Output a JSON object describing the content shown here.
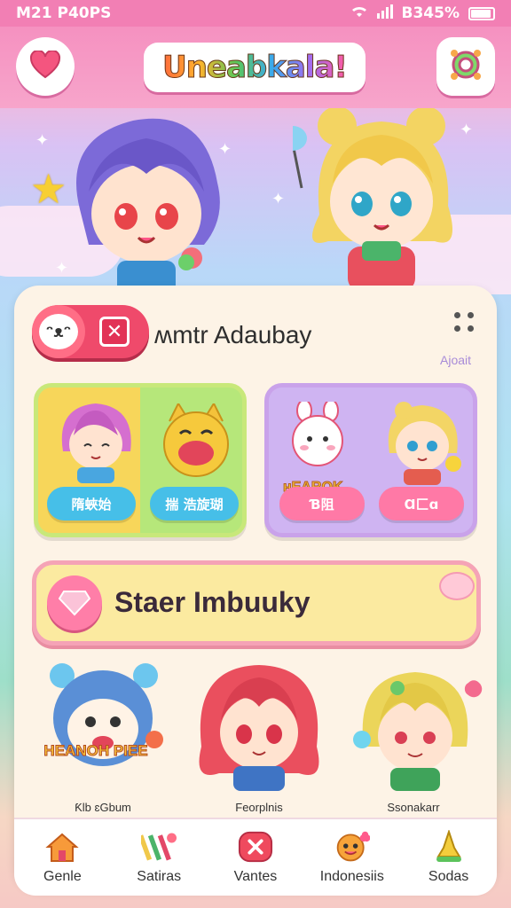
{
  "status_bar": {
    "left": "M21 P40PS",
    "right": "B345%"
  },
  "header": {
    "app_title": "Uneabkala!"
  },
  "section": {
    "title": "ʍmtr Adaubay",
    "about_label": "Ajoait"
  },
  "cards": [
    {
      "chips": [
        {
          "label": "隋蛺始",
          "color": "blue"
        },
        {
          "label": "揣 浩旋瑚",
          "color": "blue"
        }
      ]
    },
    {
      "chips": [
        {
          "label": "Ɓ阻",
          "color": "pink"
        },
        {
          "label": "Ɑ匚ɑ",
          "color": "pink"
        }
      ],
      "sign": "ʜEAROK"
    }
  ],
  "banner": {
    "text": "Staer Imbuuky"
  },
  "characters": [
    {
      "caption": "Ƙlb ɛGbum",
      "sign": "HEANOH PIEE"
    },
    {
      "caption": "Feorplnis"
    },
    {
      "caption": "Ssonakarr"
    }
  ],
  "nav": [
    {
      "label": "Genle",
      "icon": "house-icon"
    },
    {
      "label": "Satiras",
      "icon": "sticks-icon"
    },
    {
      "label": "Vantes",
      "icon": "x-badge-icon"
    },
    {
      "label": "Indonesiis",
      "icon": "face-icon"
    },
    {
      "label": "Sodas",
      "icon": "bell-icon"
    }
  ]
}
